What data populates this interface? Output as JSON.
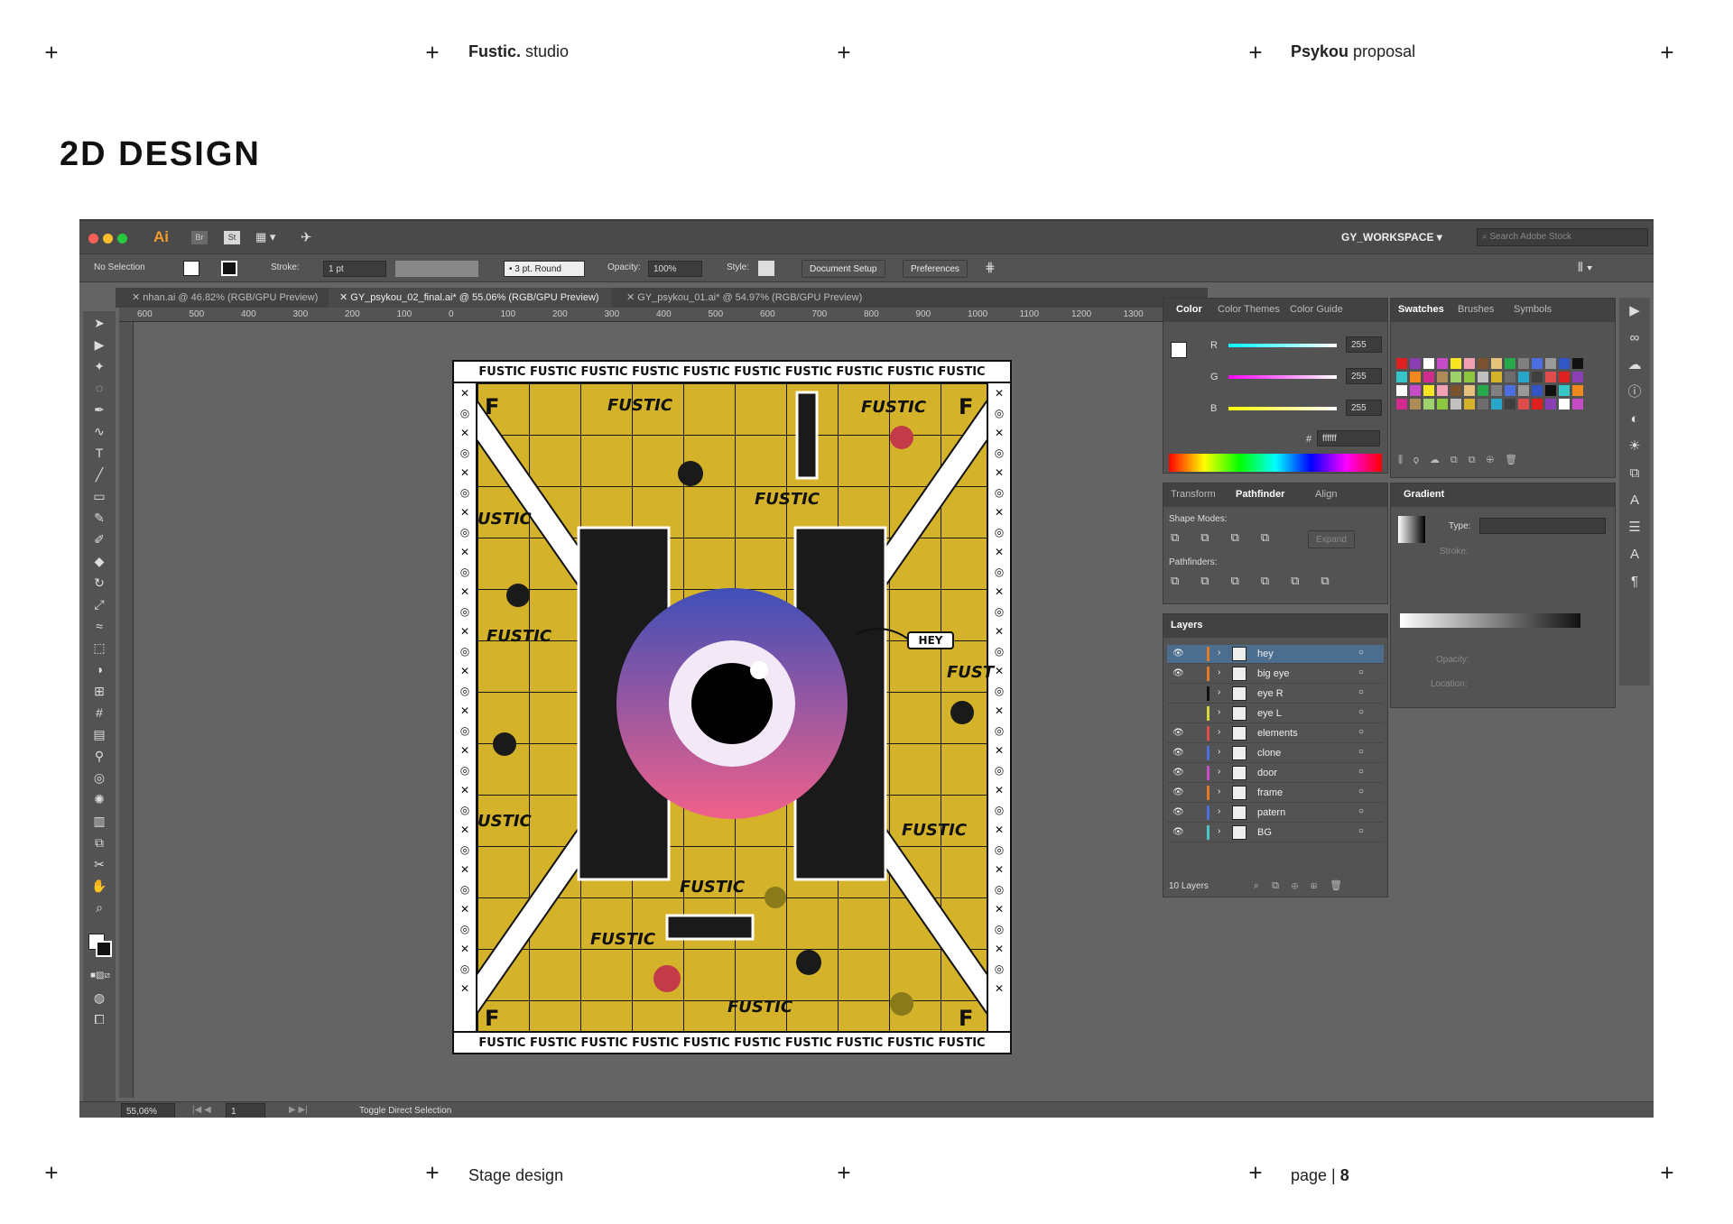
{
  "page": {
    "studio_name": "Fustic.",
    "studio_suffix": "studio",
    "client_name": "Psykou",
    "client_suffix": "proposal",
    "section_title": "2D DESIGN",
    "footer_left": "Stage design",
    "footer_page_prefix": "page |",
    "footer_page_number": "8",
    "cross_glyph": "+"
  },
  "app": {
    "logo": "Ai",
    "bridge_label": "Br",
    "stock_label": "St",
    "workspace": "GY_WORKSPACE",
    "search_placeholder": "Search Adobe Stock"
  },
  "control_bar": {
    "selection": "No Selection",
    "stroke_label": "Stroke:",
    "stroke_value": "1 pt",
    "brush_value": "3 pt. Round",
    "opacity_label": "Opacity:",
    "opacity_value": "100%",
    "style_label": "Style:",
    "document_setup": "Document Setup",
    "preferences": "Preferences"
  },
  "tabs": [
    {
      "label": "nhan.ai @ 46.82% (RGB/GPU Preview)"
    },
    {
      "label": "GY_psykou_02_final.ai* @ 55.06% (RGB/GPU Preview)"
    },
    {
      "label": "GY_psykou_01.ai* @ 54.97% (RGB/GPU Preview)"
    }
  ],
  "ruler": {
    "ticks": [
      "600",
      "500",
      "400",
      "300",
      "200",
      "100",
      "0",
      "100",
      "200",
      "300",
      "400",
      "500",
      "600",
      "700",
      "800",
      "900",
      "1000",
      "1100",
      "1200",
      "1300"
    ]
  },
  "color_panel": {
    "tabs": [
      "Color",
      "Color Themes",
      "Color Guide"
    ],
    "r_label": "R",
    "r_value": "255",
    "g_label": "G",
    "g_value": "255",
    "b_label": "B",
    "b_value": "255",
    "hex_prefix": "#",
    "hex_value": "ffffff"
  },
  "pathfinder_panel": {
    "tabs": [
      "Transform",
      "Pathfinder",
      "Align"
    ],
    "shape_modes": "Shape Modes:",
    "expand": "Expand",
    "pathfinders": "Pathfinders:"
  },
  "layers_panel": {
    "title": "Layers",
    "count": "10 Layers",
    "layers": [
      {
        "name": "hey",
        "color": "#e07a24",
        "visible": true
      },
      {
        "name": "big eye",
        "color": "#e07a24",
        "visible": true
      },
      {
        "name": "eye R",
        "color": "#111111",
        "visible": false
      },
      {
        "name": "eye L",
        "color": "#d8d83a",
        "visible": false
      },
      {
        "name": "elements",
        "color": "#e04b4b",
        "visible": true
      },
      {
        "name": "clone",
        "color": "#4b6fe0",
        "visible": true
      },
      {
        "name": "door",
        "color": "#c64bc6",
        "visible": true
      },
      {
        "name": "frame",
        "color": "#e07a24",
        "visible": true
      },
      {
        "name": "patern",
        "color": "#4b6fe0",
        "visible": true
      },
      {
        "name": "BG",
        "color": "#4bc6c6",
        "visible": true
      }
    ]
  },
  "swatches_panel": {
    "tabs": [
      "Swatches",
      "Brushes",
      "Symbols"
    ]
  },
  "gradient_panel": {
    "title": "Gradient",
    "type_label": "Type:",
    "stroke_label": "Stroke:",
    "opacity_label": "Opacity:",
    "location_label": "Location:"
  },
  "status_bar": {
    "zoom": "55,06%",
    "artboard": "1",
    "message": "Toggle Direct Selection"
  },
  "artwork": {
    "band_text": "FUSTIC FUSTIC FUSTIC FUSTIC FUSTIC FUSTIC FUSTIC FUSTIC FUSTIC FUSTIC",
    "word": "FUSTIC",
    "word_fragment": "USTIC",
    "word_fragment_right": "FUST",
    "corner_letter": "F",
    "speech_bubble": "HEY",
    "colors": {
      "yellow": "#d4b22a",
      "black": "#1a1a1a",
      "eye_top": "#3f4fb8",
      "eye_bottom": "#f0608a"
    }
  }
}
